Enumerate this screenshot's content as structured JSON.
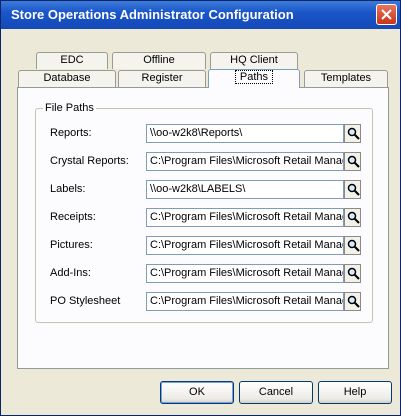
{
  "window": {
    "title": "Store Operations Administrator Configuration"
  },
  "tabs": {
    "row1": [
      {
        "label": "EDC"
      },
      {
        "label": "Offline"
      },
      {
        "label": "HQ Client"
      }
    ],
    "row2": [
      {
        "label": "Database"
      },
      {
        "label": "Register"
      },
      {
        "label": "Paths",
        "active": true
      },
      {
        "label": "Templates"
      }
    ]
  },
  "file_paths": {
    "group_label": "File Paths",
    "rows": [
      {
        "label": "Reports:",
        "value": "\\\\oo-w2k8\\Reports\\"
      },
      {
        "label": "Crystal Reports:",
        "value": "C:\\Program Files\\Microsoft Retail Manag"
      },
      {
        "label": "Labels:",
        "value": "\\\\oo-w2k8\\LABELS\\"
      },
      {
        "label": "Receipts:",
        "value": "C:\\Program Files\\Microsoft Retail Manag"
      },
      {
        "label": "Pictures:",
        "value": "C:\\Program Files\\Microsoft Retail Manag"
      },
      {
        "label": "Add-Ins:",
        "value": "C:\\Program Files\\Microsoft Retail Manag"
      },
      {
        "label": "PO Stylesheet",
        "value": "C:\\Program Files\\Microsoft Retail Manag"
      }
    ],
    "browse_icon": "magnifier-icon"
  },
  "buttons": {
    "ok": "OK",
    "cancel": "Cancel",
    "help": "Help"
  }
}
